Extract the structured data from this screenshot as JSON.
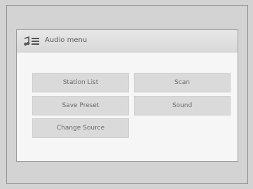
{
  "header": {
    "title": "Audio menu",
    "icon": "music-note-list-icon"
  },
  "menu": {
    "items": [
      {
        "label": "Station List"
      },
      {
        "label": "Scan"
      },
      {
        "label": "Save Preset"
      },
      {
        "label": "Sound"
      },
      {
        "label": "Change Source"
      }
    ]
  }
}
